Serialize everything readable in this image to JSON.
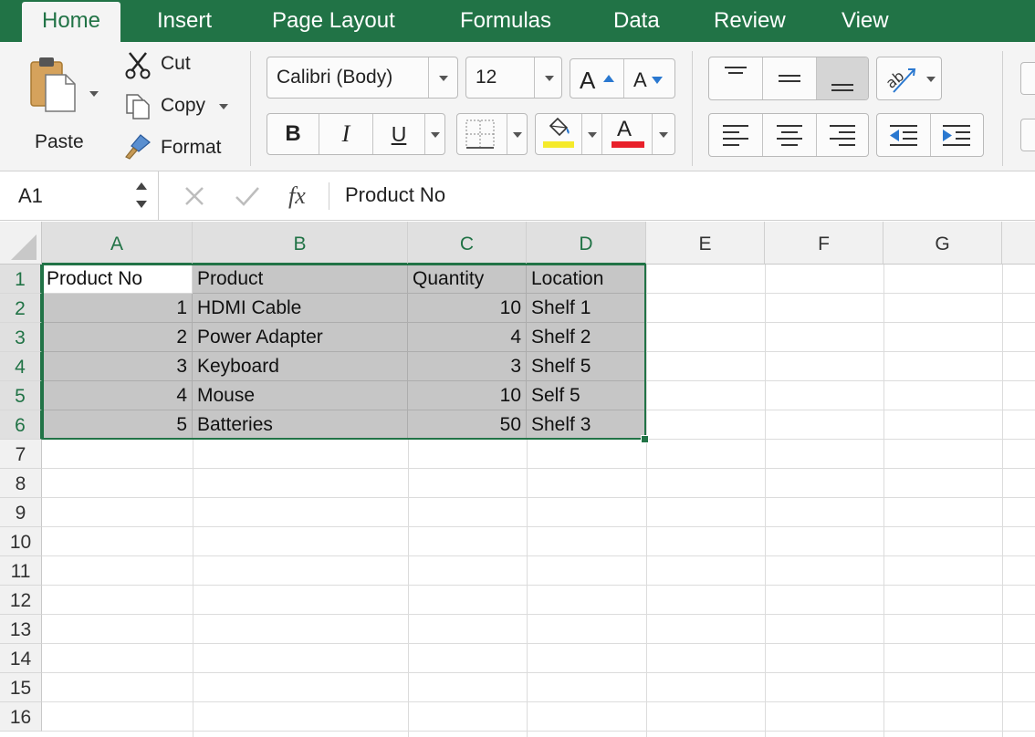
{
  "tabs": [
    {
      "label": "Home",
      "active": true
    },
    {
      "label": "Insert"
    },
    {
      "label": "Page Layout"
    },
    {
      "label": "Formulas"
    },
    {
      "label": "Data"
    },
    {
      "label": "Review"
    },
    {
      "label": "View"
    }
  ],
  "clipboard": {
    "paste_label": "Paste",
    "cut_label": "Cut",
    "copy_label": "Copy",
    "format_label": "Format"
  },
  "font": {
    "family": "Calibri (Body)",
    "size": "12",
    "bold_label": "B",
    "italic_label": "I",
    "underline_label": "U",
    "font_color_label": "A",
    "grow_label": "A",
    "shrink_label": "A",
    "fill_color": "#f5ea2a",
    "text_color": "#e8202a"
  },
  "formula_bar": {
    "name_box": "A1",
    "fx_label": "fx",
    "formula": "Product No"
  },
  "columns": [
    "A",
    "B",
    "C",
    "D",
    "E",
    "F",
    "G"
  ],
  "rows": [
    "1",
    "2",
    "3",
    "4",
    "5",
    "6",
    "7",
    "8",
    "9",
    "10",
    "11",
    "12",
    "13",
    "14",
    "15",
    "16"
  ],
  "table": [
    [
      "Product No",
      "Product",
      "Quantity",
      "Location"
    ],
    [
      "1",
      "HDMI Cable",
      "10",
      "Shelf 1"
    ],
    [
      "2",
      "Power Adapter",
      "4",
      "Shelf 2"
    ],
    [
      "3",
      "Keyboard",
      "3",
      "Shelf 5"
    ],
    [
      "4",
      "Mouse",
      "10",
      "Self 5"
    ],
    [
      "5",
      "Batteries",
      "50",
      "Shelf 3"
    ]
  ],
  "colors": {
    "accent": "#217346",
    "selection": "#c6c6c6"
  }
}
